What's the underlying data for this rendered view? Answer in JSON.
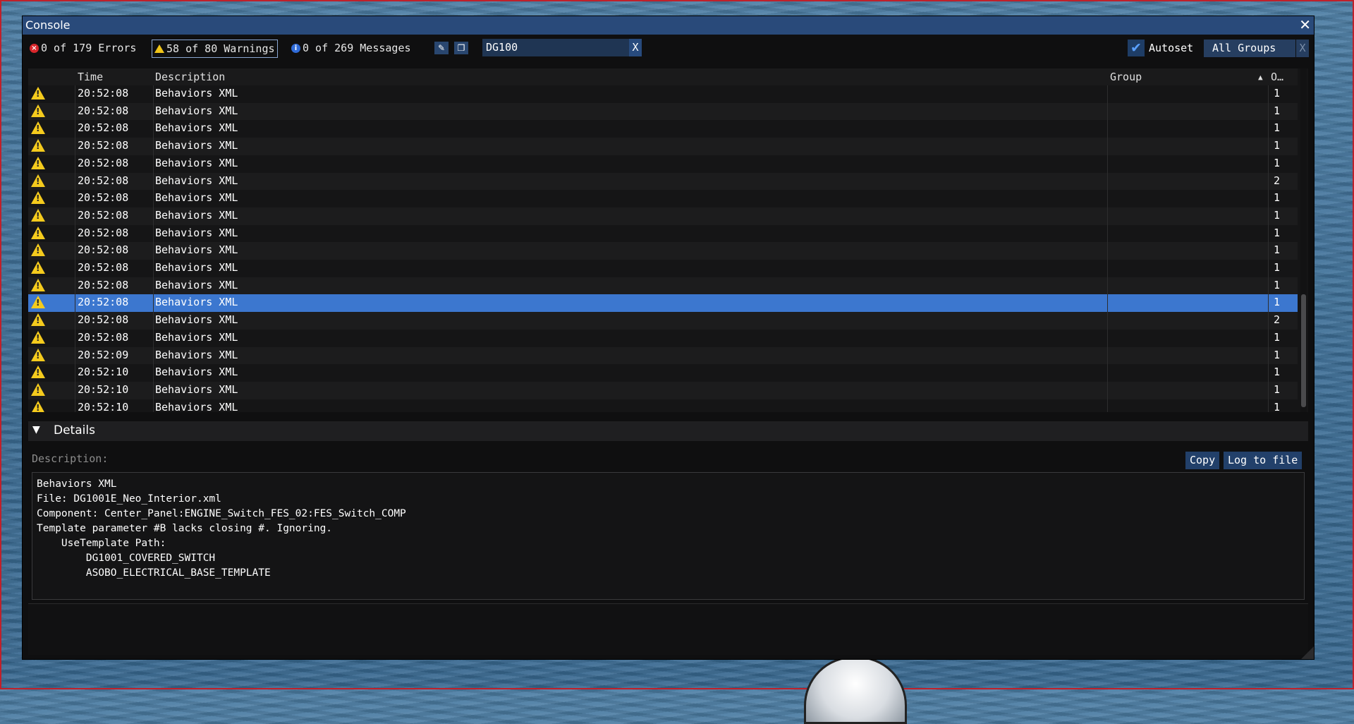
{
  "window": {
    "title": "Console"
  },
  "toolbar": {
    "errors_label": "0 of 179 Errors",
    "warnings_label": "58 of 80 Warnings",
    "messages_label": "0 of 269 Messages",
    "search_value": "DG100",
    "search_clear_label": "X",
    "autoset_label": "Autoset",
    "groups_label": "All Groups",
    "groups_clear_label": "X"
  },
  "table": {
    "headers": {
      "time": "Time",
      "description": "Description",
      "group": "Group",
      "count": "O…"
    },
    "rows": [
      {
        "time": "20:52:08",
        "description": "Behaviors XML",
        "count": "1"
      },
      {
        "time": "20:52:08",
        "description": "Behaviors XML",
        "count": "1"
      },
      {
        "time": "20:52:08",
        "description": "Behaviors XML",
        "count": "1"
      },
      {
        "time": "20:52:08",
        "description": "Behaviors XML",
        "count": "1"
      },
      {
        "time": "20:52:08",
        "description": "Behaviors XML",
        "count": "1"
      },
      {
        "time": "20:52:08",
        "description": "Behaviors XML",
        "count": "2"
      },
      {
        "time": "20:52:08",
        "description": "Behaviors XML",
        "count": "1"
      },
      {
        "time": "20:52:08",
        "description": "Behaviors XML",
        "count": "1"
      },
      {
        "time": "20:52:08",
        "description": "Behaviors XML",
        "count": "1"
      },
      {
        "time": "20:52:08",
        "description": "Behaviors XML",
        "count": "1"
      },
      {
        "time": "20:52:08",
        "description": "Behaviors XML",
        "count": "1"
      },
      {
        "time": "20:52:08",
        "description": "Behaviors XML",
        "count": "1"
      },
      {
        "time": "20:52:08",
        "description": "Behaviors XML",
        "count": "1"
      },
      {
        "time": "20:52:08",
        "description": "Behaviors XML",
        "count": "2"
      },
      {
        "time": "20:52:08",
        "description": "Behaviors XML",
        "count": "1"
      },
      {
        "time": "20:52:09",
        "description": "Behaviors XML",
        "count": "1"
      },
      {
        "time": "20:52:10",
        "description": "Behaviors XML",
        "count": "1"
      },
      {
        "time": "20:52:10",
        "description": "Behaviors XML",
        "count": "1"
      },
      {
        "time": "20:52:10",
        "description": "Behaviors XML",
        "count": "1"
      }
    ],
    "selected_index": 12
  },
  "details": {
    "header": "Details",
    "description_label": "Description:",
    "copy_label": "Copy",
    "log_label": "Log to file",
    "lines": [
      "Behaviors XML",
      "File: DG1001E_Neo_Interior.xml",
      "Component: Center_Panel:ENGINE_Switch_FES_02:FES_Switch_COMP",
      "Template parameter #B lacks closing #. Ignoring.",
      "    UseTemplate Path:",
      "        DG1001_COVERED_SWITCH",
      "        ASOBO_ELECTRICAL_BASE_TEMPLATE"
    ]
  },
  "colors": {
    "title_bar": "#294a7a",
    "selected_row": "#3c77cf",
    "warning": "#f5cb1d",
    "error": "#d8262b",
    "info": "#2f6bd8"
  }
}
